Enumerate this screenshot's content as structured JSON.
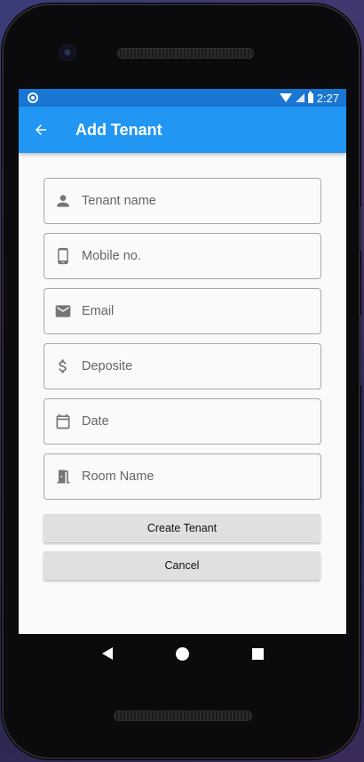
{
  "status_bar": {
    "time": "2:27"
  },
  "app_bar": {
    "title": "Add Tenant",
    "back_icon": "arrow-back-icon"
  },
  "form": {
    "fields": [
      {
        "placeholder": "Tenant name",
        "value": "",
        "icon": "person-icon"
      },
      {
        "placeholder": "Mobile no.",
        "value": "",
        "icon": "phone-icon"
      },
      {
        "placeholder": "Email",
        "value": "",
        "icon": "email-icon"
      },
      {
        "placeholder": "Deposite",
        "value": "",
        "icon": "dollar-icon"
      },
      {
        "placeholder": "Date",
        "value": "",
        "icon": "calendar-icon"
      },
      {
        "placeholder": "Room Name",
        "value": "",
        "icon": "door-icon"
      }
    ],
    "create_label": "Create Tenant",
    "cancel_label": "Cancel"
  },
  "colors": {
    "app_bar": "#2196f3",
    "status_bar": "#1976d2",
    "background": "#fafafa",
    "button": "#e0e0e0"
  }
}
